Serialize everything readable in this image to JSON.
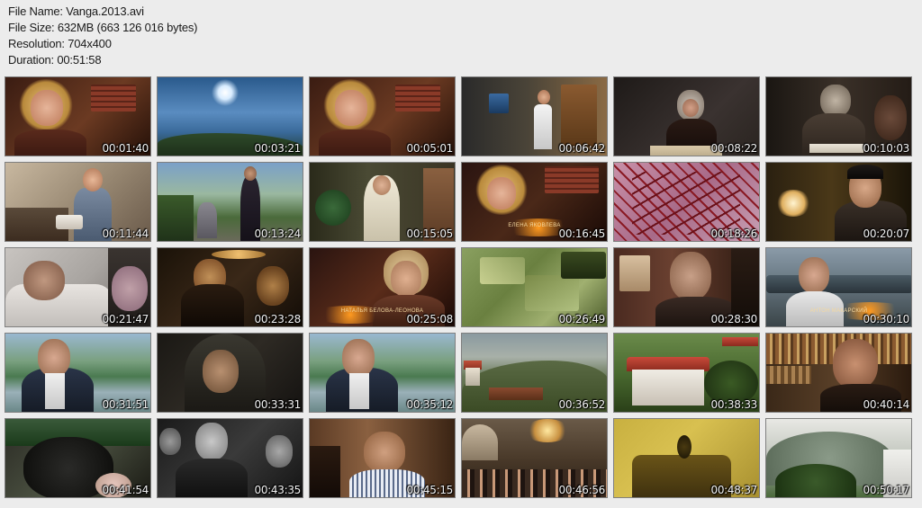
{
  "file_info": {
    "name": "File Name: Vanga.2013.avi",
    "size": "File Size: 632MB (663 126 016 bytes)",
    "resolution": "Resolution: 704x400",
    "duration": "Duration: 00:51:58"
  },
  "thumbnails": [
    {
      "time": "00:01:40",
      "scene": "woman-blonde-brick",
      "caption": ""
    },
    {
      "time": "00:03:21",
      "scene": "sky-mountains",
      "caption": ""
    },
    {
      "time": "00:05:01",
      "scene": "woman-blonde-brick",
      "caption": ""
    },
    {
      "time": "00:06:42",
      "scene": "man-office",
      "caption": ""
    },
    {
      "time": "00:08:22",
      "scene": "old-woman-headscarf",
      "caption": ""
    },
    {
      "time": "00:10:03",
      "scene": "old-woman-table",
      "caption": ""
    },
    {
      "time": "00:11:44",
      "scene": "man-workshop",
      "caption": ""
    },
    {
      "time": "00:13:24",
      "scene": "village-road",
      "caption": ""
    },
    {
      "time": "00:15:05",
      "scene": "woman-white-scarf",
      "caption": ""
    },
    {
      "time": "00:16:45",
      "scene": "woman-blonde-caption",
      "caption": "ЕЛЕНА ЯКОВЛЕВА"
    },
    {
      "time": "00:18:26",
      "scene": "red-branches",
      "caption": ""
    },
    {
      "time": "00:20:07",
      "scene": "man-lamp",
      "caption": ""
    },
    {
      "time": "00:21:47",
      "scene": "man-bed",
      "caption": ""
    },
    {
      "time": "00:23:28",
      "scene": "sepia-crowd",
      "caption": ""
    },
    {
      "time": "00:25:08",
      "scene": "older-woman-caption",
      "caption": "НАТАЛЬЯ БЕЛОВА-ЛЕОНОВА"
    },
    {
      "time": "00:26:49",
      "scene": "green-bills",
      "caption": ""
    },
    {
      "time": "00:28:30",
      "scene": "old-man-room",
      "caption": ""
    },
    {
      "time": "00:30:10",
      "scene": "man-street-caption",
      "caption": "АНТОН МАКАРСКИЙ"
    },
    {
      "time": "00:31:51",
      "scene": "host-river",
      "caption": ""
    },
    {
      "time": "00:33:31",
      "scene": "veiled-woman",
      "caption": ""
    },
    {
      "time": "00:35:12",
      "scene": "host-river",
      "caption": ""
    },
    {
      "time": "00:36:52",
      "scene": "mountain-village",
      "caption": ""
    },
    {
      "time": "00:38:33",
      "scene": "red-roof-house",
      "caption": ""
    },
    {
      "time": "00:40:14",
      "scene": "bearded-man-books",
      "caption": ""
    },
    {
      "time": "00:41:54",
      "scene": "dark-figure",
      "caption": ""
    },
    {
      "time": "00:43:35",
      "scene": "bw-men-crowd",
      "caption": ""
    },
    {
      "time": "00:45:15",
      "scene": "man-striped-shirt",
      "caption": ""
    },
    {
      "time": "00:46:56",
      "scene": "church-crowd",
      "caption": ""
    },
    {
      "time": "00:48:37",
      "scene": "yellow-bird",
      "caption": ""
    },
    {
      "time": "00:50:17",
      "scene": "misty-hill",
      "caption": ""
    }
  ]
}
